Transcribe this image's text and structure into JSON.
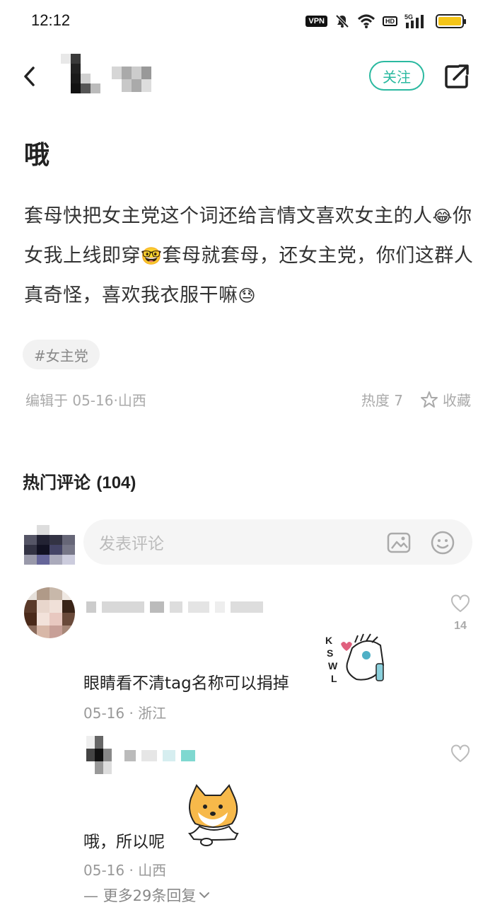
{
  "status_bar": {
    "time": "12:12",
    "vpn": "VPN",
    "hd": "HD",
    "network": "5G",
    "battery_level": 1.0,
    "battery_color": "#f5c518"
  },
  "header": {
    "follow_label": "关注",
    "accent_color": "#2bb9a0"
  },
  "post": {
    "title": "哦",
    "body_parts": [
      "套母快把女主党这个词还给言情文喜欢女主的人",
      "😂",
      "你女我上线即穿",
      "🤓",
      "套母就套母，还女主党，你们这群人真奇怪，喜欢我衣服干嘛",
      "😓"
    ],
    "tag": "#女主党",
    "meta": "编辑于 05-16·山西",
    "heat": "热度 7",
    "collect_label": "收藏"
  },
  "comments": {
    "section_title": "热门评论",
    "count": "(104)",
    "input_placeholder": "发表评论",
    "items": [
      {
        "text": "眼睛看不清tag名称可以捐掉",
        "meta": "05-16 · 浙江",
        "likes": "14",
        "sticker": "KSWL"
      },
      {
        "text": "哦，所以呢",
        "meta": "05-16 · 山西",
        "likes": ""
      }
    ],
    "more_replies": "— 更多29条回复"
  }
}
